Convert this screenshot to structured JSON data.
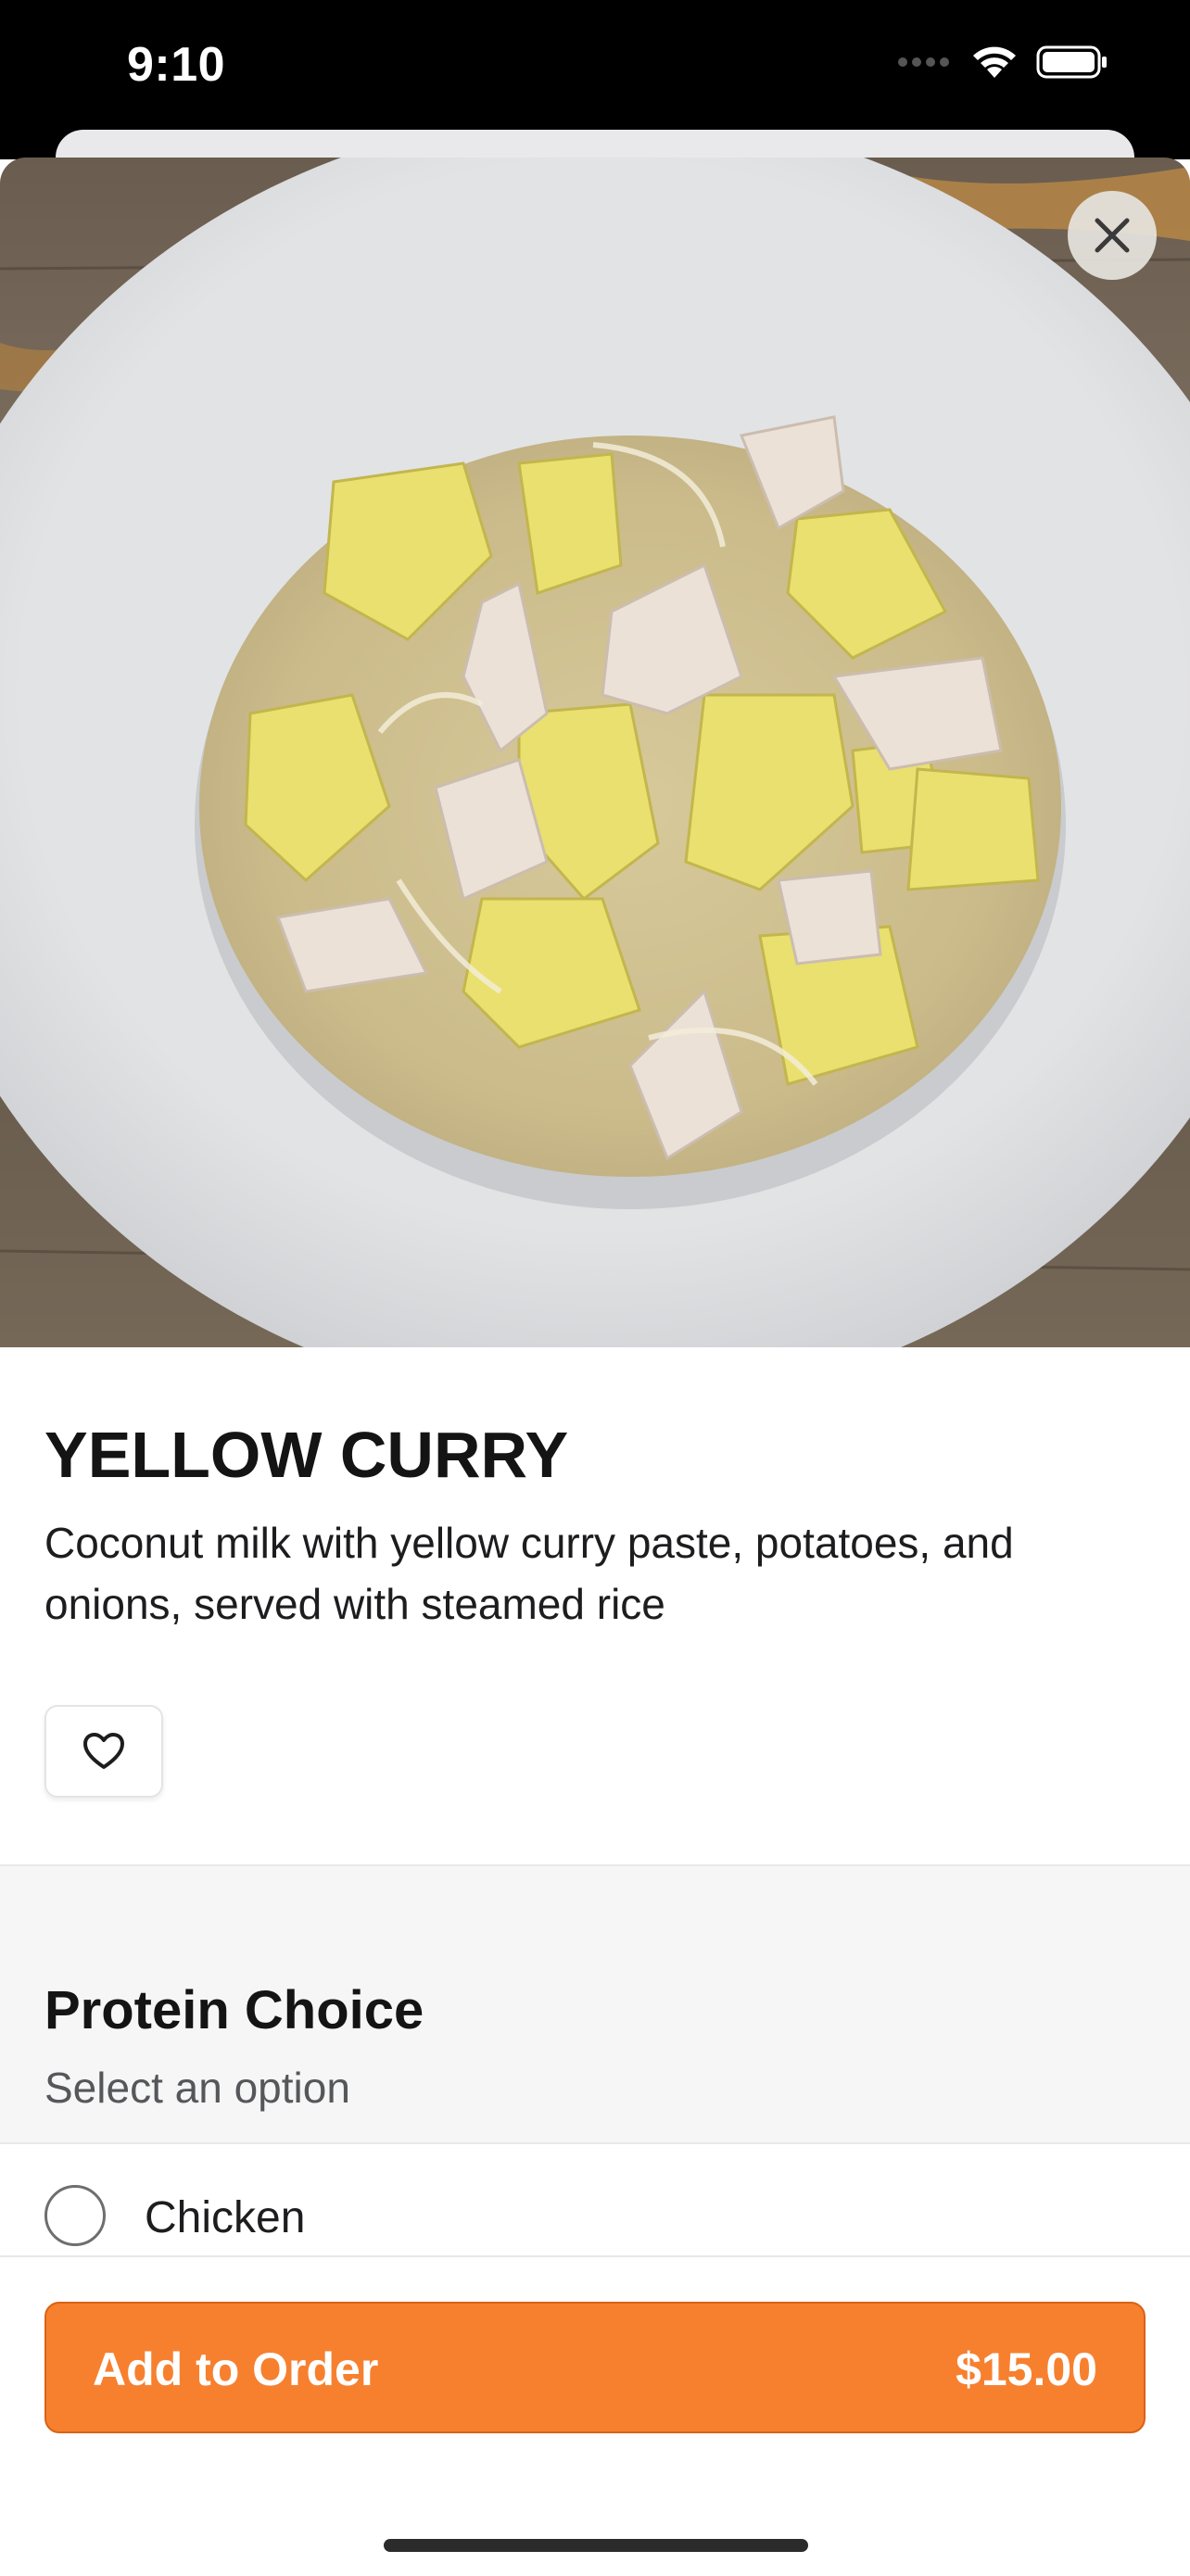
{
  "status_bar": {
    "time": "9:10"
  },
  "item": {
    "title": "YELLOW CURRY",
    "description": "Coconut milk with yellow curry paste, potatoes, and onions, served with steamed rice",
    "image_alt": "Bowl of yellow curry with chicken, potatoes and onions"
  },
  "section": {
    "title": "Protein Choice",
    "subtitle": "Select an option",
    "options": [
      {
        "label": "Chicken",
        "selected": false
      }
    ]
  },
  "cta": {
    "label": "Add to Order",
    "price": "$15.00"
  },
  "colors": {
    "accent": "#f7802f",
    "accent_border": "#d96215",
    "section_bg": "#f6f6f6"
  },
  "icons": {
    "close": "close-icon",
    "favorite": "heart-icon"
  }
}
